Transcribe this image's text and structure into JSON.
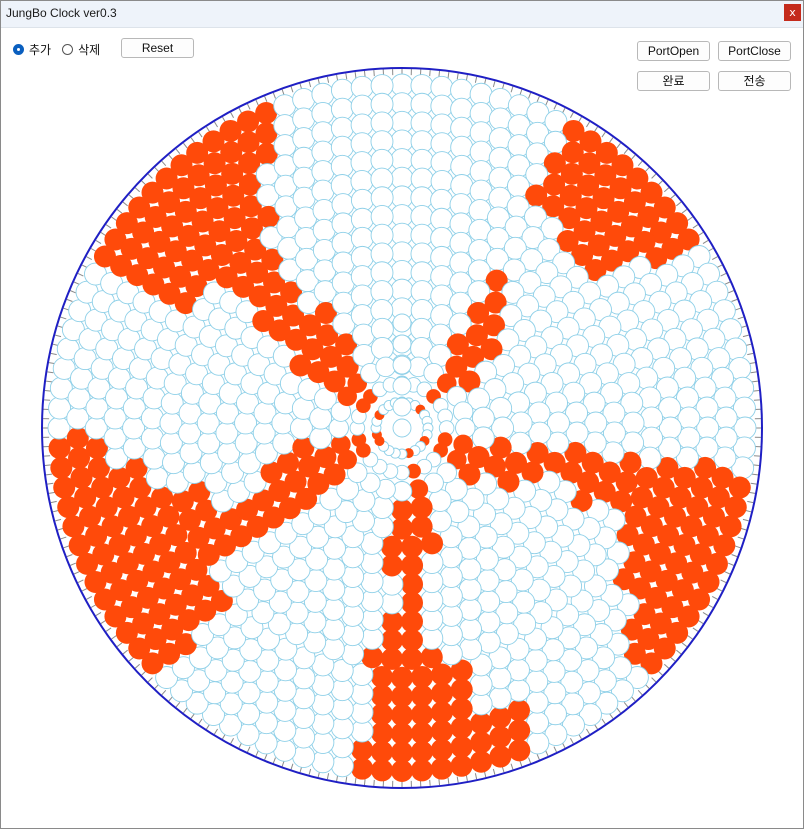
{
  "window": {
    "title": "JungBo Clock ver0.3",
    "close_glyph": "x"
  },
  "mode": {
    "options": [
      {
        "label": "추가",
        "checked": true
      },
      {
        "label": "삭제",
        "checked": false
      }
    ]
  },
  "buttons": {
    "reset": "Reset",
    "port_open": "PortOpen",
    "port_close": "PortClose",
    "done": "완료",
    "send": "전송"
  },
  "colors": {
    "ring": "#1f1fc4",
    "led_off_stroke": "#8fd0e8",
    "led_on": "#ff4a0a",
    "tick": "#8a8a8a",
    "radio_accent": "#0a5fbf"
  },
  "led_grid": {
    "rings": 18,
    "active_pattern": [
      [
        0,
        0,
        0,
        0,
        1,
        1,
        1,
        1,
        0,
        0,
        0,
        0,
        0,
        1,
        1,
        1,
        1,
        1,
        0,
        0,
        0,
        1,
        1,
        1,
        1,
        0,
        0,
        0,
        0,
        0,
        1,
        1,
        1,
        1,
        1,
        1,
        0,
        0,
        0,
        0,
        1,
        1,
        1,
        1,
        1,
        0,
        0,
        0
      ],
      [
        0,
        0,
        0,
        0,
        1,
        1,
        1,
        1,
        0,
        0,
        0,
        0,
        0,
        1,
        1,
        1,
        1,
        1,
        0,
        0,
        0,
        1,
        1,
        1,
        1,
        0,
        0,
        0,
        0,
        0,
        1,
        1,
        1,
        1,
        1,
        1,
        0,
        0,
        0,
        0,
        1,
        1,
        1,
        1,
        1,
        0,
        0,
        0
      ],
      [
        0,
        0,
        0,
        0,
        1,
        1,
        1,
        0,
        0,
        0,
        0,
        0,
        0,
        1,
        1,
        1,
        1,
        0,
        0,
        0,
        0,
        0,
        1,
        1,
        1,
        0,
        0,
        0,
        0,
        0,
        1,
        1,
        1,
        1,
        1,
        0,
        0,
        0,
        0,
        0,
        1,
        1,
        1,
        1,
        0,
        0,
        0,
        0
      ],
      [
        0,
        0,
        0,
        0,
        0,
        1,
        1,
        0,
        0,
        0,
        0,
        0,
        0,
        1,
        1,
        1,
        0,
        0,
        0,
        0,
        0,
        0,
        1,
        1,
        1,
        0,
        0,
        0,
        0,
        0,
        1,
        1,
        1,
        1,
        0,
        0,
        0,
        0,
        0,
        0,
        1,
        1,
        1,
        1,
        0,
        0,
        0,
        0
      ],
      [
        0,
        0,
        0,
        0,
        0,
        0,
        0,
        0,
        0,
        0,
        0,
        0,
        0,
        1,
        1,
        0,
        0,
        0,
        0,
        0,
        0,
        0,
        0,
        1,
        1,
        0,
        0,
        0,
        0,
        0,
        0,
        1,
        1,
        1,
        0,
        0,
        0,
        0,
        0,
        0,
        0,
        1,
        1,
        0,
        0,
        0,
        0,
        0
      ],
      [
        0,
        0,
        0,
        0,
        0,
        0,
        0,
        0,
        0,
        0,
        0,
        0,
        0,
        1,
        1,
        0,
        0,
        0,
        0,
        0,
        0,
        0,
        0,
        1,
        1,
        0,
        0,
        0,
        0,
        0,
        0,
        1,
        1,
        0,
        0,
        0,
        0,
        0,
        0,
        0,
        0,
        1,
        1,
        0,
        0,
        0,
        0,
        0
      ],
      [
        0,
        0,
        0,
        0,
        1,
        0,
        0,
        0,
        0,
        0,
        0,
        0,
        0,
        1,
        0,
        0,
        0,
        0,
        0,
        0,
        0,
        0,
        0,
        1,
        0,
        0,
        0,
        0,
        0,
        0,
        0,
        1,
        1,
        0,
        0,
        0,
        0,
        0,
        0,
        0,
        0,
        1,
        1,
        0,
        0,
        0,
        0,
        0
      ],
      [
        0,
        0,
        0,
        0,
        1,
        1,
        0,
        0,
        0,
        0,
        0,
        0,
        0,
        1,
        1,
        0,
        0,
        0,
        0,
        0,
        0,
        0,
        0,
        1,
        1,
        0,
        0,
        0,
        0,
        0,
        0,
        1,
        1,
        1,
        0,
        0,
        0,
        0,
        0,
        0,
        0,
        1,
        1,
        1,
        0,
        0,
        0,
        0
      ],
      [
        0,
        0,
        0,
        0,
        1,
        1,
        1,
        0,
        0,
        0,
        0,
        0,
        0,
        1,
        1,
        1,
        0,
        0,
        0,
        0,
        0,
        0,
        1,
        1,
        1,
        0,
        0,
        0,
        0,
        0,
        0,
        1,
        1,
        1,
        1,
        0,
        0,
        0,
        0,
        0,
        1,
        1,
        1,
        1,
        0,
        0,
        0,
        0
      ],
      [
        0,
        0,
        0,
        0,
        1,
        1,
        1,
        1,
        0,
        0,
        0,
        0,
        0,
        1,
        1,
        1,
        1,
        0,
        0,
        0,
        0,
        1,
        1,
        1,
        1,
        0,
        0,
        0,
        0,
        0,
        1,
        1,
        1,
        1,
        1,
        0,
        0,
        0,
        0,
        1,
        1,
        1,
        1,
        1,
        0,
        0,
        0,
        0
      ],
      [
        0,
        0,
        0,
        0,
        0,
        1,
        1,
        1,
        0,
        0,
        0,
        0,
        0,
        0,
        1,
        1,
        1,
        0,
        0,
        0,
        0,
        1,
        1,
        1,
        0,
        0,
        0,
        0,
        0,
        0,
        0,
        1,
        1,
        1,
        1,
        0,
        0,
        0,
        0,
        0,
        1,
        1,
        1,
        0,
        0,
        0,
        0,
        0
      ],
      [
        0,
        0,
        0,
        0,
        0,
        0,
        1,
        1,
        0,
        0,
        0,
        0,
        0,
        0,
        0,
        1,
        1,
        0,
        0,
        0,
        0,
        1,
        1,
        0,
        0,
        0,
        0,
        0,
        0,
        0,
        0,
        0,
        1,
        1,
        1,
        0,
        0,
        0,
        0,
        0,
        1,
        1,
        0,
        0,
        0,
        0,
        0,
        0
      ]
    ]
  }
}
